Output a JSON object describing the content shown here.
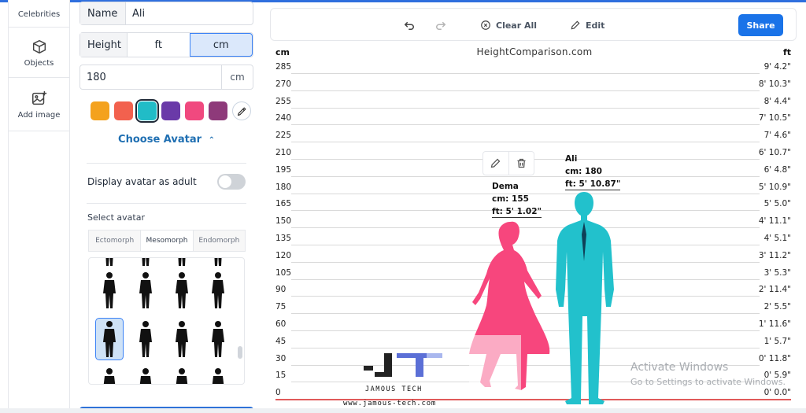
{
  "nav": {
    "items": [
      {
        "label": "Celebrities",
        "icon": "star-icon"
      },
      {
        "label": "Objects",
        "icon": "cube-icon"
      },
      {
        "label": "Add image",
        "icon": "add-image-icon"
      }
    ]
  },
  "form": {
    "name_label": "Name",
    "name_value": "Ali",
    "height_label": "Height",
    "unit_ft": "ft",
    "unit_cm": "cm",
    "height_value": "180",
    "value_unit": "cm",
    "colors": [
      "#f4a21e",
      "#f2614e",
      "#21bcc7",
      "#6a3aa8",
      "#f0497f",
      "#8e3a7a"
    ],
    "selected_color": "#21bcc7",
    "choose_avatar": "Choose Avatar",
    "display_adult": "Display avatar as adult",
    "display_adult_on": false,
    "select_avatar": "Select avatar",
    "body_tabs": [
      "Ectomorph",
      "Mesomorph",
      "Endomorph"
    ],
    "active_body_tab": "Mesomorph"
  },
  "toolbar": {
    "clear_all": "Clear All",
    "edit": "Edit",
    "share": "Share"
  },
  "chart": {
    "site": "HeightComparison.com",
    "left_unit": "cm",
    "right_unit": "ft",
    "rows": [
      {
        "cm": "285",
        "ft": "9' 4.2\""
      },
      {
        "cm": "270",
        "ft": "8' 10.3\""
      },
      {
        "cm": "255",
        "ft": "8' 4.4\""
      },
      {
        "cm": "240",
        "ft": "7' 10.5\""
      },
      {
        "cm": "225",
        "ft": "7' 4.6\""
      },
      {
        "cm": "210",
        "ft": "6' 10.7\""
      },
      {
        "cm": "195",
        "ft": "6' 4.8\""
      },
      {
        "cm": "180",
        "ft": "5' 10.9\""
      },
      {
        "cm": "165",
        "ft": "5' 5.0\""
      },
      {
        "cm": "150",
        "ft": "4' 11.1\""
      },
      {
        "cm": "135",
        "ft": "4' 5.1\""
      },
      {
        "cm": "120",
        "ft": "3' 11.2\""
      },
      {
        "cm": "105",
        "ft": "3' 5.3\""
      },
      {
        "cm": "90",
        "ft": "2' 11.4\""
      },
      {
        "cm": "75",
        "ft": "2' 5.5\""
      },
      {
        "cm": "60",
        "ft": "1' 11.6\""
      },
      {
        "cm": "45",
        "ft": "1' 5.7\""
      },
      {
        "cm": "30",
        "ft": "0' 11.8\""
      },
      {
        "cm": "15",
        "ft": "0' 5.9\""
      },
      {
        "cm": "0",
        "ft": "0' 0.0\""
      }
    ],
    "people": [
      {
        "name": "Dema",
        "cm": "cm: 155",
        "ft": "ft: 5' 1.02\"",
        "color": "#f7467d"
      },
      {
        "name": "Ali",
        "cm": "cm: 180",
        "ft": "ft: 5' 10.87\"",
        "color": "#22c1cc"
      }
    ]
  },
  "watermarks": {
    "brand": "JAMOUS TECH",
    "url": "www.jamous-tech.com",
    "activate_title": "Activate Windows",
    "activate_sub": "Go to Settings to activate Windows."
  }
}
